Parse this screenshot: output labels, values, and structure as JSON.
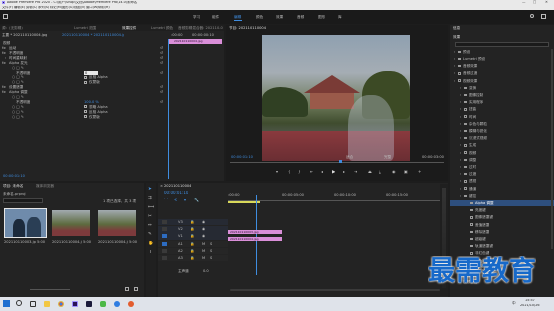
{
  "titlebar": {
    "title": "Adobe Premiere Pro 2020 - C:\\用户\\Shop\\文档\\Adobe\\Premiere Pro\\14.0\\未命名",
    "min": "—",
    "max": "□",
    "close": "✕"
  },
  "menubar": [
    "文件(F)",
    "编辑(E)",
    "剪辑(C)",
    "序列(S)",
    "标记(M)",
    "图形(G)",
    "视图(V)",
    "窗口(W)",
    "帮助(H)"
  ],
  "workspaces": {
    "items": [
      "学习",
      "组件",
      "编辑",
      "颜色",
      "效果",
      "音频",
      "图形",
      "库"
    ],
    "active_index": 2
  },
  "effect_controls": {
    "tabs": [
      "源：(无剪辑)",
      "Lumetri 范围",
      "效果控件",
      "Lumetri 颜色",
      "音频剪辑混合器: 202110-004"
    ],
    "active_tab_index": 2,
    "master_label": "主要 * 202110110004.jpg",
    "clip_label": "202110110004 * 202110110004.jpg",
    "timecode_top": ":00:00",
    "timecode_right": "00:00:00:10",
    "section_video": "视频",
    "effects": [
      {
        "name": "运动",
        "indent": 1,
        "fx": "fx"
      },
      {
        "name": "不透明度",
        "indent": 1,
        "fx": "fx"
      },
      {
        "name": "时间重映射",
        "indent": 1,
        "fx": ""
      },
      {
        "name": "Alpha 发光",
        "indent": 1,
        "fx": "fx"
      },
      {
        "name": "",
        "indent": 2,
        "fx": ""
      },
      {
        "name": "不透明度",
        "indent": 2,
        "fx": "",
        "value": "0",
        "input": true
      },
      {
        "name": "",
        "indent": 2,
        "fx": "",
        "checkbox": "反相 Alpha"
      },
      {
        "name": "",
        "indent": 2,
        "fx": "",
        "checkbox": "仅蒙版"
      },
      {
        "name": "设置遮罩",
        "indent": 1,
        "fx": "fx"
      },
      {
        "name": "Alpha 调整",
        "indent": 1,
        "fx": "fx"
      },
      {
        "name": "",
        "indent": 2,
        "fx": ""
      },
      {
        "name": "不透明度",
        "indent": 2,
        "fx": "",
        "value": "100.0 %"
      },
      {
        "name": "",
        "indent": 2,
        "fx": "",
        "checkbox": "忽略 Alpha"
      },
      {
        "name": "",
        "indent": 2,
        "fx": "",
        "checkbox": "反相 Alpha"
      },
      {
        "name": "",
        "indent": 2,
        "fx": "",
        "checkbox": "仅蒙版"
      }
    ],
    "clip_bar": "202110110004.jpg",
    "footer_time": "00:00:01:10"
  },
  "program_monitor": {
    "title": "节目: 202110110004",
    "timecode": "00:00:01:10",
    "fit": "适合",
    "quality": "完整",
    "duration": "00:00:03:00"
  },
  "project": {
    "tabs": [
      "项目: 未命名",
      "媒体浏览器"
    ],
    "path": "未命名.prproj",
    "selection_info": "1 项已选择，共 3 项",
    "thumbnails": [
      {
        "name": "202110110003.jpg",
        "duration": "5:00",
        "kind": "people"
      },
      {
        "name": "202110110004.jpg",
        "duration": "5:00",
        "kind": "campus"
      },
      {
        "name": "202110110004.jpg",
        "duration": "5:00",
        "kind": "campus"
      }
    ]
  },
  "timeline": {
    "title": "202110110004",
    "timecode": "00:00:01:10",
    "ruler": [
      ":00:00",
      "00:00:05:00",
      "00:00:10:00",
      "00:00:15:00"
    ],
    "tracks": [
      "V3",
      "V2",
      "V1",
      "A1",
      "A2",
      "A3"
    ],
    "master": "主声道",
    "master_value": "0.0",
    "clips": [
      {
        "label": "202110110003.jpg",
        "track": "V2"
      },
      {
        "label": "202110110004.jpg",
        "track": "V1"
      }
    ]
  },
  "effects_panel": {
    "header_tabs": [
      "信息",
      "效果"
    ],
    "search_placeholder": "",
    "tree": [
      {
        "label": "预设",
        "depth": 0
      },
      {
        "label": "Lumetri 预设",
        "depth": 0
      },
      {
        "label": "音频效果",
        "depth": 0
      },
      {
        "label": "音频过渡",
        "depth": 0
      },
      {
        "label": "视频效果",
        "depth": 0
      },
      {
        "label": "变换",
        "depth": 1
      },
      {
        "label": "图像控制",
        "depth": 1
      },
      {
        "label": "实用程序",
        "depth": 1
      },
      {
        "label": "扭曲",
        "depth": 1
      },
      {
        "label": "时间",
        "depth": 1
      },
      {
        "label": "杂色与颗粒",
        "depth": 1
      },
      {
        "label": "模糊与锐化",
        "depth": 1
      },
      {
        "label": "沉浸式视频",
        "depth": 1
      },
      {
        "label": "生成",
        "depth": 1
      },
      {
        "label": "视频",
        "depth": 1
      },
      {
        "label": "调整",
        "depth": 1
      },
      {
        "label": "过时",
        "depth": 1
      },
      {
        "label": "过渡",
        "depth": 1
      },
      {
        "label": "透视",
        "depth": 1
      },
      {
        "label": "通道",
        "depth": 1
      },
      {
        "label": "键控",
        "depth": 1
      },
      {
        "label": "Alpha 调整",
        "depth": 2,
        "selected": true
      },
      {
        "label": "亮度键",
        "depth": 2
      },
      {
        "label": "图像遮罩键",
        "depth": 2
      },
      {
        "label": "差值遮罩",
        "depth": 2
      },
      {
        "label": "移除遮罩",
        "depth": 2
      },
      {
        "label": "超级键",
        "depth": 2
      },
      {
        "label": "轨道遮罩键",
        "depth": 2
      },
      {
        "label": "非红色键",
        "depth": 2
      },
      {
        "label": "颜色键",
        "depth": 2
      },
      {
        "label": "颜色校正",
        "depth": 1
      },
      {
        "label": "风格化",
        "depth": 1
      },
      {
        "label": "视频过渡",
        "depth": 0
      }
    ]
  },
  "taskbar": {
    "time": "15:57",
    "date": "2021/10/26",
    "lang": "中"
  },
  "watermark": "最需教育",
  "colors": {
    "accent_blue": "#2d8ceb",
    "clip_pink": "#d98ed8",
    "selection": "#2e4f7e",
    "watermark_blue": "#1769c9"
  }
}
